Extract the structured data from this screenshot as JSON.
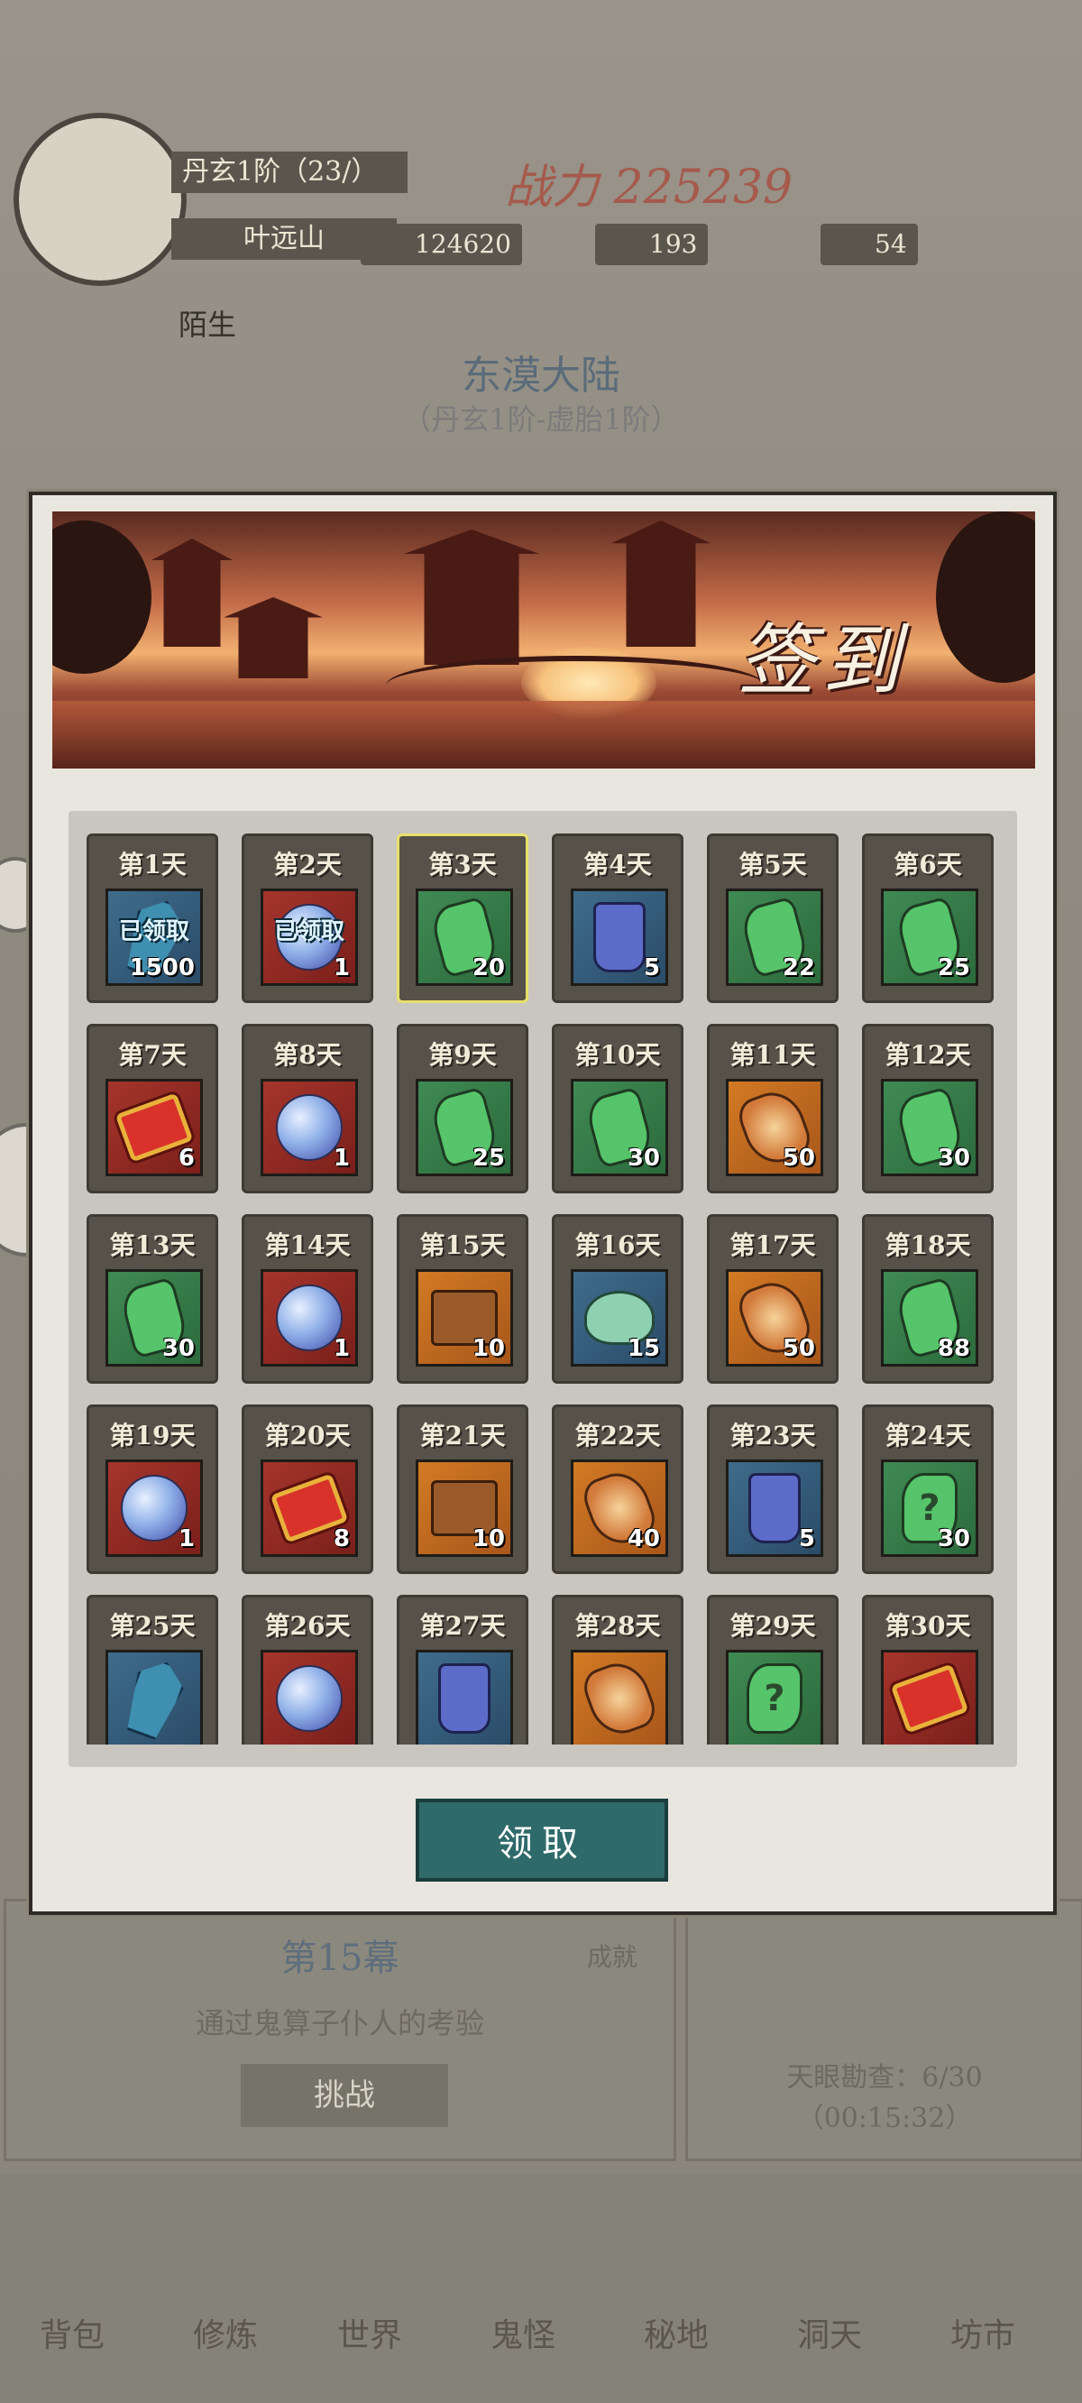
{
  "background": {
    "player_name": "丹玄1阶（23/）",
    "player_sub": "叶远山",
    "power_label": "战力",
    "power_value": "225239",
    "resources": [
      "124620",
      "193",
      "54"
    ],
    "side_label": "陌生",
    "region_title": "东漠大陆",
    "region_sub": "（丹玄1阶-虚胎1阶）",
    "stage_title": "第15幕",
    "stage_desc": "通过鬼算子仆人的考验",
    "stage_button": "挑战",
    "achievement": "成就",
    "eye_task": "天眼勘查：6/30",
    "eye_timer": "（00:15:32）",
    "nav": [
      "背包",
      "修炼",
      "世界",
      "鬼怪",
      "秘地",
      "洞天",
      "坊市"
    ]
  },
  "modal": {
    "banner_title": "签到",
    "claim_button": "领取",
    "claimed_text": "已领取",
    "days": [
      {
        "label": "第1天",
        "item": "crystal",
        "color": "blue",
        "qty": "1500",
        "claimed": true
      },
      {
        "label": "第2天",
        "item": "orb",
        "color": "red",
        "qty": "1",
        "claimed": true
      },
      {
        "label": "第3天",
        "item": "jade",
        "color": "green",
        "qty": "20",
        "current": true
      },
      {
        "label": "第4天",
        "item": "robe",
        "color": "blue",
        "qty": "5"
      },
      {
        "label": "第5天",
        "item": "jade",
        "color": "green",
        "qty": "22"
      },
      {
        "label": "第6天",
        "item": "jade",
        "color": "green",
        "qty": "25"
      },
      {
        "label": "第7天",
        "item": "scroll",
        "color": "red",
        "qty": "6"
      },
      {
        "label": "第8天",
        "item": "orb",
        "color": "red",
        "qty": "1"
      },
      {
        "label": "第9天",
        "item": "jade",
        "color": "green",
        "qty": "25"
      },
      {
        "label": "第10天",
        "item": "jade",
        "color": "green",
        "qty": "30"
      },
      {
        "label": "第11天",
        "item": "stone",
        "color": "orange",
        "qty": "50"
      },
      {
        "label": "第12天",
        "item": "jade",
        "color": "green",
        "qty": "30"
      },
      {
        "label": "第13天",
        "item": "jade",
        "color": "green",
        "qty": "30"
      },
      {
        "label": "第14天",
        "item": "orb",
        "color": "red",
        "qty": "1"
      },
      {
        "label": "第15天",
        "item": "puzzle",
        "color": "orange",
        "qty": "10"
      },
      {
        "label": "第16天",
        "item": "dragon",
        "color": "blue",
        "qty": "15"
      },
      {
        "label": "第17天",
        "item": "stone",
        "color": "orange",
        "qty": "50"
      },
      {
        "label": "第18天",
        "item": "jade",
        "color": "green",
        "qty": "88"
      },
      {
        "label": "第19天",
        "item": "orb",
        "color": "red",
        "qty": "1"
      },
      {
        "label": "第20天",
        "item": "scroll",
        "color": "red",
        "qty": "8"
      },
      {
        "label": "第21天",
        "item": "puzzle",
        "color": "orange",
        "qty": "10"
      },
      {
        "label": "第22天",
        "item": "stone",
        "color": "orange",
        "qty": "40"
      },
      {
        "label": "第23天",
        "item": "robe",
        "color": "blue",
        "qty": "5"
      },
      {
        "label": "第24天",
        "item": "mystery",
        "color": "green",
        "qty": "30"
      },
      {
        "label": "第25天",
        "item": "crystal",
        "color": "blue",
        "qty": ""
      },
      {
        "label": "第26天",
        "item": "orb",
        "color": "red",
        "qty": ""
      },
      {
        "label": "第27天",
        "item": "robe",
        "color": "blue",
        "qty": ""
      },
      {
        "label": "第28天",
        "item": "stone",
        "color": "orange",
        "qty": ""
      },
      {
        "label": "第29天",
        "item": "mystery",
        "color": "green",
        "qty": ""
      },
      {
        "label": "第30天",
        "item": "scroll",
        "color": "red",
        "qty": ""
      }
    ]
  }
}
